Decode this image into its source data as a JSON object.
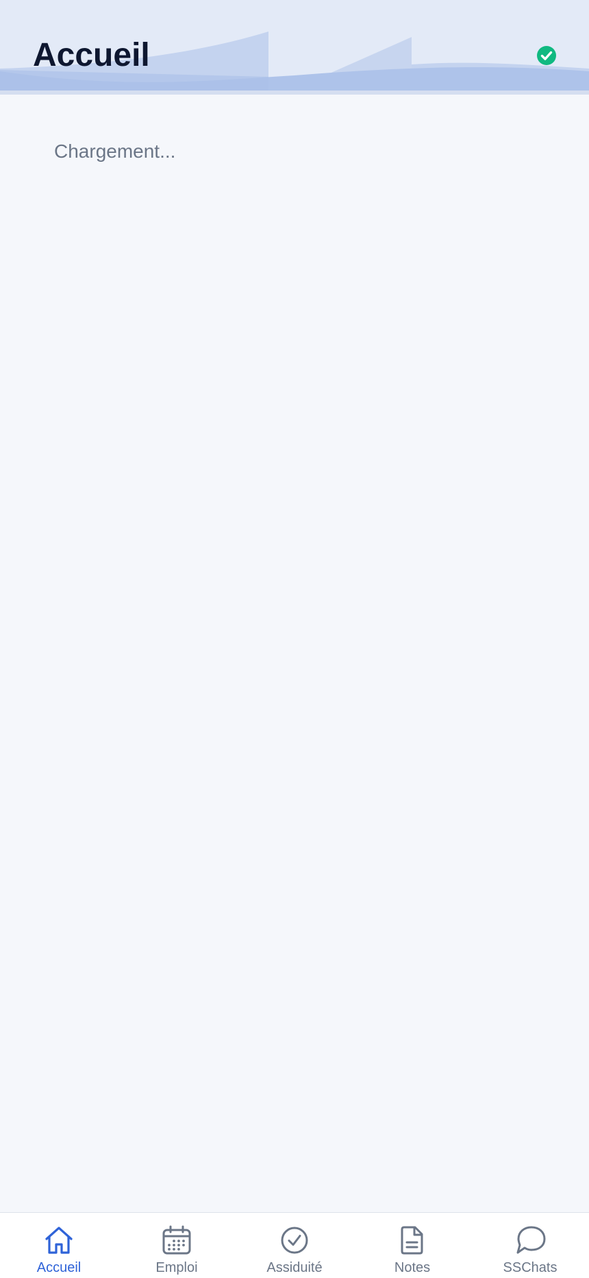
{
  "header": {
    "title": "Accueil",
    "status_icon": "check-circle-icon",
    "status_color": "#10b981"
  },
  "content": {
    "loading_text": "Chargement..."
  },
  "bottom_nav": {
    "active_color": "#2f63d8",
    "inactive_color": "#6b7687",
    "items": [
      {
        "label": "Accueil",
        "icon": "home-icon",
        "active": true
      },
      {
        "label": "Emploi",
        "icon": "calendar-icon",
        "active": false
      },
      {
        "label": "Assiduité",
        "icon": "check-circle-icon",
        "active": false
      },
      {
        "label": "Notes",
        "icon": "document-icon",
        "active": false
      },
      {
        "label": "SSChats",
        "icon": "chat-bubble-icon",
        "active": false
      }
    ]
  }
}
